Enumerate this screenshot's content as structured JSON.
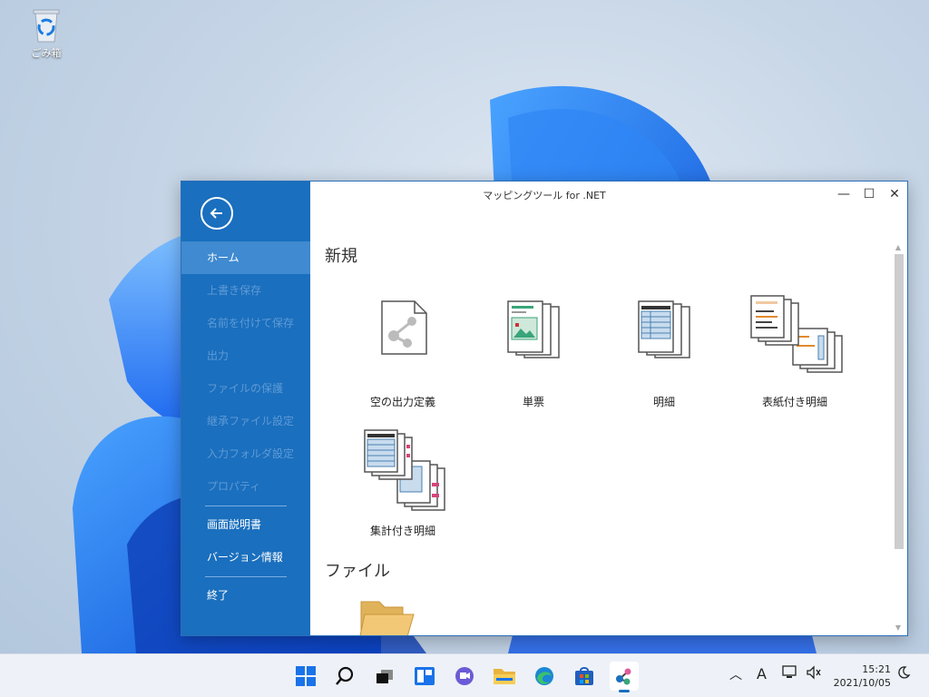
{
  "desktop": {
    "recycle_bin_label": "ごみ箱"
  },
  "window": {
    "title": "マッピングツール for .NET",
    "controls": {
      "minimize": "—",
      "maximize": "☐",
      "close": "✕"
    }
  },
  "sidebar": {
    "items": [
      {
        "label": "ホーム",
        "state": "active"
      },
      {
        "label": "上書き保存",
        "state": "disabled"
      },
      {
        "label": "名前を付けて保存",
        "state": "disabled"
      },
      {
        "label": "出力",
        "state": "disabled"
      },
      {
        "label": "ファイルの保護",
        "state": "disabled"
      },
      {
        "label": "継承ファイル設定",
        "state": "disabled"
      },
      {
        "label": "入力フォルダ設定",
        "state": "disabled"
      },
      {
        "label": "プロパティ",
        "state": "disabled"
      },
      {
        "label": "画面説明書",
        "state": "enabled"
      },
      {
        "label": "バージョン情報",
        "state": "enabled"
      },
      {
        "label": "終了",
        "state": "enabled"
      }
    ]
  },
  "main": {
    "section_new": "新規",
    "templates": [
      {
        "label": "空の出力定義",
        "icon": "blank-document-icon"
      },
      {
        "label": "単票",
        "icon": "single-form-icon"
      },
      {
        "label": "明細",
        "icon": "detail-list-icon"
      },
      {
        "label": "表紙付き明細",
        "icon": "cover-detail-icon"
      },
      {
        "label": "集計付き明細",
        "icon": "summary-detail-icon"
      }
    ],
    "section_file": "ファイル"
  },
  "taskbar": {
    "apps": [
      "start-icon",
      "search-icon",
      "task-view-icon",
      "widgets-icon",
      "chat-icon",
      "file-explorer-icon",
      "edge-icon",
      "store-icon",
      "mapping-tool-icon"
    ],
    "tray_ime": "A",
    "time": "15:21",
    "date": "2021/10/05"
  },
  "colors": {
    "sidebar": "#1a6fbe",
    "sidebar_active": "#3f8ad0",
    "accent": "#1a6fbe"
  }
}
